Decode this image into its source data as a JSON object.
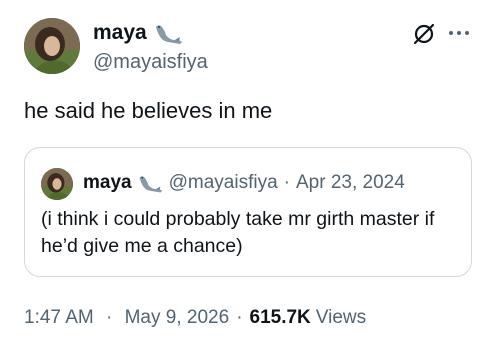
{
  "author": {
    "display_name": "maya",
    "handle": "@mayaisfiya",
    "avatar_icon": "profile-photo",
    "badge_icon": "seal-emoji"
  },
  "tweet": {
    "text": "he said he believes in me"
  },
  "quote": {
    "display_name": "maya",
    "handle": "@mayaisfiya",
    "separator": "·",
    "date": "Apr 23, 2024",
    "text": "(i think i could probably take mr girth master if he’d give me a chance)"
  },
  "meta": {
    "time": "1:47 AM",
    "separator": "·",
    "date": "May 9, 2026",
    "views_count": "615.7K",
    "views_label": "Views"
  },
  "icons": {
    "grok": "grok-icon",
    "more": "more-options-icon"
  },
  "colors": {
    "text_primary": "#0f1419",
    "text_secondary": "#536471",
    "border": "#cfd9de",
    "background": "#ffffff"
  }
}
